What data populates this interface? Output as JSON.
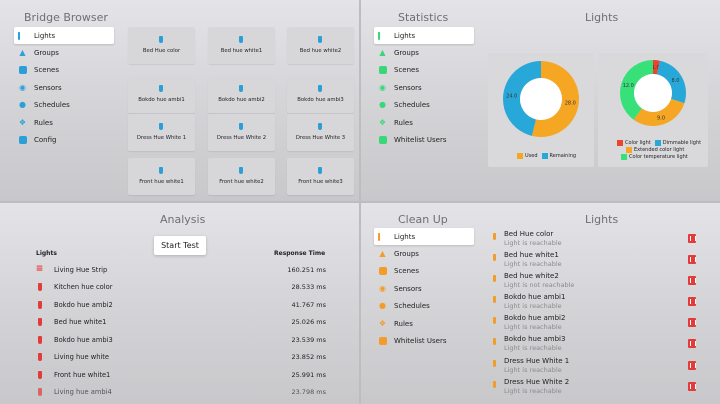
{
  "q1": {
    "title": "Bridge Browser",
    "sidebar": [
      {
        "label": "Lights",
        "icon": "light-icon",
        "selected": true
      },
      {
        "label": "Groups",
        "icon": "groups-icon"
      },
      {
        "label": "Scenes",
        "icon": "scenes-icon"
      },
      {
        "label": "Sensors",
        "icon": "sensors-icon"
      },
      {
        "label": "Schedules",
        "icon": "schedules-icon"
      },
      {
        "label": "Rules",
        "icon": "rules-icon"
      },
      {
        "label": "Config",
        "icon": "config-icon"
      }
    ],
    "lights": [
      "Bed Hue color",
      "Bed hue white1",
      "Bed hue white2",
      "Bokdo hue ambi1",
      "Bokdo hue ambi2",
      "Bokdo hue ambi3",
      "Dress Hue White 1",
      "Dress Hue White 2",
      "Dress Hue White 3",
      "Front hue white1",
      "Front hue white2",
      "Front hue white3"
    ]
  },
  "q2": {
    "title": "Statistics",
    "subtitle": "Lights",
    "sidebar": [
      {
        "label": "Lights",
        "selected": true
      },
      {
        "label": "Groups"
      },
      {
        "label": "Scenes"
      },
      {
        "label": "Sensors"
      },
      {
        "label": "Schedules"
      },
      {
        "label": "Rules"
      },
      {
        "label": "Whitelist Users"
      }
    ],
    "chart_data": [
      {
        "type": "pie",
        "series": [
          {
            "name": "Used",
            "value": 28.0,
            "color": "#f5a623"
          },
          {
            "name": "Remaining",
            "value": 24.0,
            "color": "#28a8d8"
          }
        ],
        "legend": [
          "Used",
          "Remaining"
        ]
      },
      {
        "type": "pie",
        "series": [
          {
            "name": "Color light",
            "value": 1.0,
            "color": "#e8452c"
          },
          {
            "name": "Dimmable light",
            "value": 8.0,
            "color": "#28a8d8"
          },
          {
            "name": "Extended color light",
            "value": 9.0,
            "color": "#f5a623"
          },
          {
            "name": "Color temperature light",
            "value": 12.0,
            "color": "#38e07a"
          }
        ],
        "legend": [
          "Color light",
          "Dimmable light",
          "Extended color light",
          "Color temperature light"
        ]
      }
    ]
  },
  "q3": {
    "title": "Analysis",
    "start_label": "Start Test",
    "col_lights": "Lights",
    "col_response": "Response Time",
    "rows": [
      {
        "name": "Living Hue Strip",
        "ms": "160.251 ms",
        "icon": "strip"
      },
      {
        "name": "Kitchen hue color",
        "ms": "28.533 ms",
        "icon": "bulb"
      },
      {
        "name": "Bokdo hue ambi2",
        "ms": "41.767 ms",
        "icon": "bulb"
      },
      {
        "name": "Bed hue white1",
        "ms": "25.026 ms",
        "icon": "bulb"
      },
      {
        "name": "Bokdo hue ambi3",
        "ms": "23.539 ms",
        "icon": "bulb"
      },
      {
        "name": "Living hue white",
        "ms": "23.852 ms",
        "icon": "bulb"
      },
      {
        "name": "Front hue white1",
        "ms": "25.991 ms",
        "icon": "bulb"
      },
      {
        "name": "Living hue ambi4",
        "ms": "23.798 ms",
        "icon": "bulb"
      }
    ]
  },
  "q4": {
    "title": "Clean Up",
    "subtitle": "Lights",
    "sidebar": [
      {
        "label": "Lights",
        "selected": true
      },
      {
        "label": "Groups"
      },
      {
        "label": "Scenes"
      },
      {
        "label": "Sensors"
      },
      {
        "label": "Schedules"
      },
      {
        "label": "Rules"
      },
      {
        "label": "Whitelist Users"
      }
    ],
    "items": [
      {
        "name": "Bed Hue color",
        "status": "Light is reachable"
      },
      {
        "name": "Bed hue white1",
        "status": "Light is reachable"
      },
      {
        "name": "Bed hue white2",
        "status": "Light is not reachable"
      },
      {
        "name": "Bokdo hue ambi1",
        "status": "Light is reachable"
      },
      {
        "name": "Bokdo hue ambi2",
        "status": "Light is reachable"
      },
      {
        "name": "Bokdo hue ambi3",
        "status": "Light is reachable"
      },
      {
        "name": "Dress Hue White 1",
        "status": "Light is reachable"
      },
      {
        "name": "Dress Hue White 2",
        "status": "Light is reachable"
      }
    ]
  }
}
